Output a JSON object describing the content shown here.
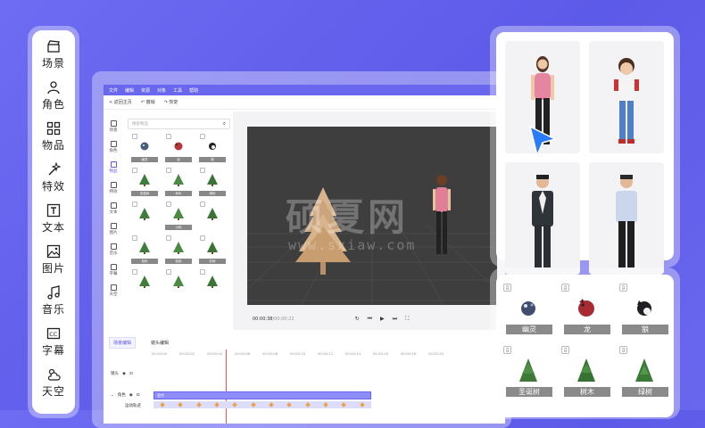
{
  "rail": {
    "items": [
      {
        "label": "场景",
        "icon": "clapperboard-icon"
      },
      {
        "label": "角色",
        "icon": "person-icon"
      },
      {
        "label": "物品",
        "icon": "grid-icon"
      },
      {
        "label": "特效",
        "icon": "magic-wand-icon"
      },
      {
        "label": "文本",
        "icon": "text-t-icon"
      },
      {
        "label": "图片",
        "icon": "image-icon"
      },
      {
        "label": "音乐",
        "icon": "music-note-icon"
      },
      {
        "label": "字幕",
        "icon": "cc-icon"
      },
      {
        "label": "天空",
        "icon": "cloud-sun-icon"
      }
    ]
  },
  "editor": {
    "menu": [
      "文件",
      "编辑",
      "资源",
      "对象",
      "工具",
      "帮助"
    ],
    "toolbar": {
      "back": "< 返回主页",
      "undo": "撤销",
      "redo": "恢复"
    },
    "side_categories": [
      "场景",
      "角色",
      "物品",
      "特效",
      "文本",
      "图片",
      "音乐",
      "字幕",
      "天空"
    ],
    "search_placeholder": "搜索物品",
    "assets": [
      {
        "label": "幽灵"
      },
      {
        "label": "龙"
      },
      {
        "label": "狼"
      },
      {
        "label": "圣诞树"
      },
      {
        "label": "树木"
      },
      {
        "label": "绿树"
      },
      {
        "label": ""
      },
      {
        "label": "小树"
      },
      {
        "label": ""
      },
      {
        "label": "松树"
      },
      {
        "label": "松树"
      },
      {
        "label": "杉树"
      },
      {
        "label": ""
      },
      {
        "label": ""
      },
      {
        "label": ""
      }
    ],
    "timecode_current": "00:00:38",
    "timecode_total": "/00:00:22",
    "timeline_tabs": [
      "场景编辑",
      "镜头编辑"
    ],
    "ruler": [
      "00:00:00",
      "00:00:02",
      "00:00:04",
      "00:00:06",
      "00:00:08",
      "00:00:10",
      "00:00:12",
      "00:00:14",
      "00:00:16",
      "00:00:18",
      "00:00:20"
    ],
    "tracks": {
      "camera": "镜头",
      "role": "角色",
      "motion": "运动轨迹"
    },
    "clip_label": "宣传"
  },
  "watermark": {
    "main": "硕夏网",
    "sub": "www.sxiaw.com"
  },
  "objects": [
    {
      "label": "幽灵"
    },
    {
      "label": "龙"
    },
    {
      "label": "狼"
    },
    {
      "label": "圣诞树"
    },
    {
      "label": "树木"
    },
    {
      "label": "绿树"
    }
  ],
  "colors": {
    "accent": "#6a67ef",
    "background": "#5f5ceb",
    "tree": "#3f7d3a"
  }
}
